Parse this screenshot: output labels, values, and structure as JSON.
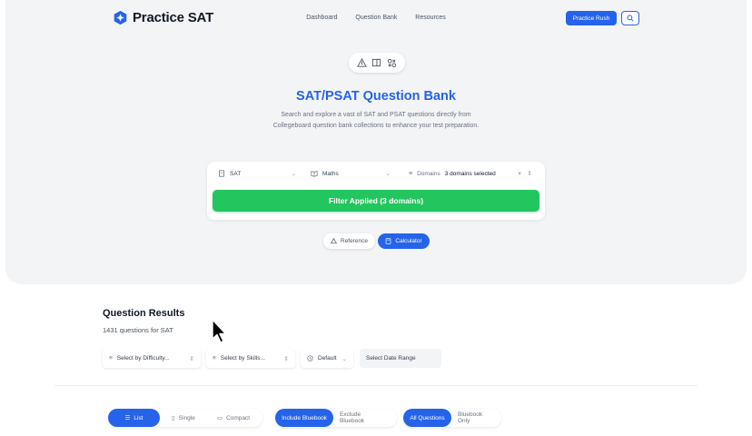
{
  "brand": {
    "name": "Practice SAT",
    "color": "#2563eb"
  },
  "nav": {
    "items": [
      "Dashboard",
      "Question Bank",
      "Resources"
    ]
  },
  "header": {
    "rush_button": "Practice Rush",
    "search_icon": "search-icon"
  },
  "hero": {
    "title": "SAT/PSAT Question Bank",
    "subtitle": "Search and explore a vast of SAT and PSAT questions directly from Collegeboard question bank collections to enhance your test preparation."
  },
  "filters": {
    "exam": "SAT",
    "subject": "Maths",
    "domains_label": "Domains",
    "domains_value": "3 domains selected",
    "apply_button": "Filter Applied (3 domains)"
  },
  "tools": {
    "reference": "Reference",
    "calculator": "Calculator"
  },
  "results": {
    "title": "Question Results",
    "count": "1431 questions for SAT",
    "difficulty": "Select by Difficulty...",
    "skills": "Select by Skills...",
    "sort": "Default",
    "date_range": "Select Date Range"
  },
  "view": {
    "list": "List",
    "single": "Single",
    "compact": "Compact",
    "include_bluebook": "Include Bluebook",
    "exclude_bluebook": "Exclude Bluebook",
    "all_questions": "All Questions",
    "bluebook_only": "Bluebook Only"
  },
  "colors": {
    "primary": "#2563eb",
    "success": "#22c55e"
  }
}
